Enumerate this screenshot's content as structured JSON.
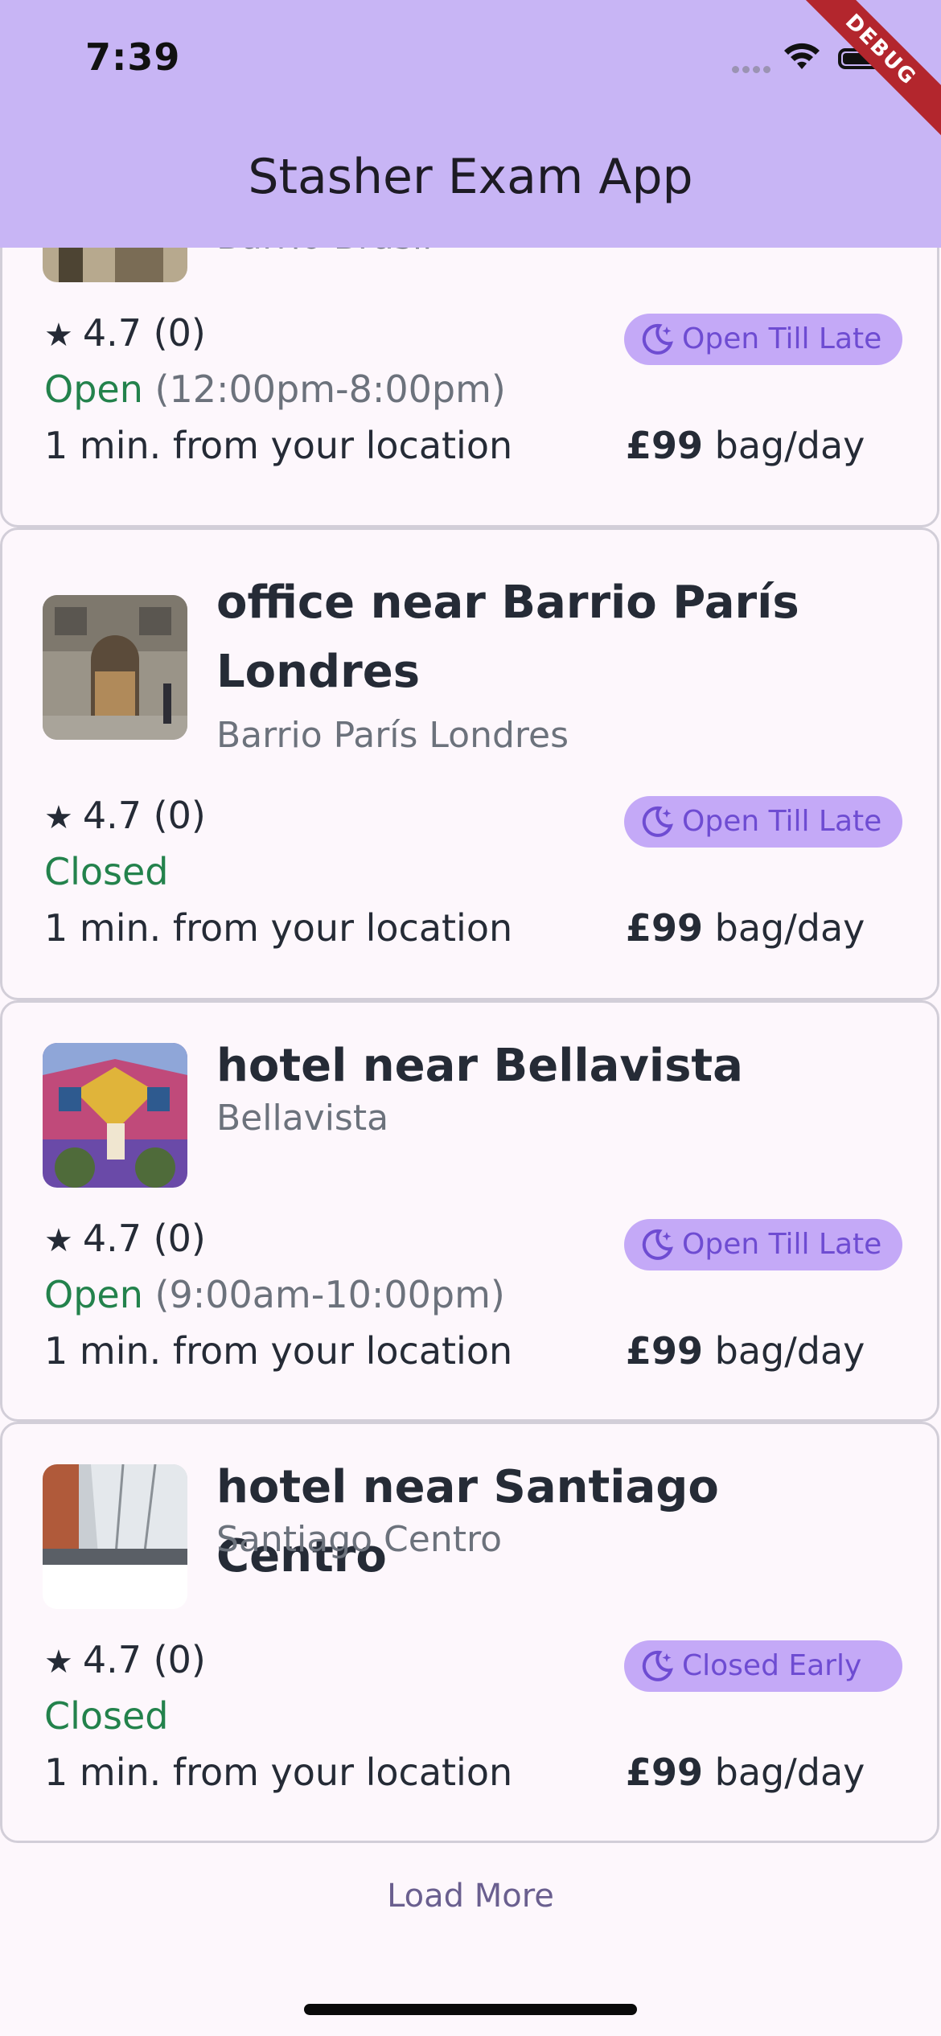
{
  "status_bar": {
    "time": "7:39"
  },
  "app_bar": {
    "title": "Stasher Exam App",
    "debug_label": "DEBUG"
  },
  "colors": {
    "appbar": "#c8b5f5",
    "badge_bg": "#c4a9f7",
    "badge_text": "#6e4cd2",
    "open_green": "#23824c",
    "debug_red": "#b3262d"
  },
  "listings": [
    {
      "title": "",
      "area": "Barrio Brasil",
      "rating": "4.7 (0)",
      "badge": "Open Till Late",
      "status": "Open",
      "hours": "(12:00pm-8:00pm)",
      "distance": "1 min. from your location",
      "price": "£99",
      "price_unit": "bag/day"
    },
    {
      "title": "office near Barrio París Londres",
      "area": "Barrio París Londres",
      "rating": "4.7 (0)",
      "badge": "Open Till Late",
      "status": "Closed",
      "hours": "",
      "distance": "1 min. from your location",
      "price": "£99",
      "price_unit": "bag/day"
    },
    {
      "title": "hotel near Bellavista",
      "area": "Bellavista",
      "rating": "4.7 (0)",
      "badge": "Open Till Late",
      "status": "Open",
      "hours": "(9:00am-10:00pm)",
      "distance": "1 min. from your location",
      "price": "£99",
      "price_unit": "bag/day"
    },
    {
      "title": "hotel near Santiago Centro",
      "area": "Santiago Centro",
      "rating": "4.7 (0)",
      "badge": "Closed Early",
      "status": "Closed",
      "hours": "",
      "distance": "1 min. from your location",
      "price": "£99",
      "price_unit": "bag/day"
    }
  ],
  "footer": {
    "load_more": "Load More"
  },
  "icons": {
    "rating": "star-icon",
    "badge": "moon-icon"
  }
}
